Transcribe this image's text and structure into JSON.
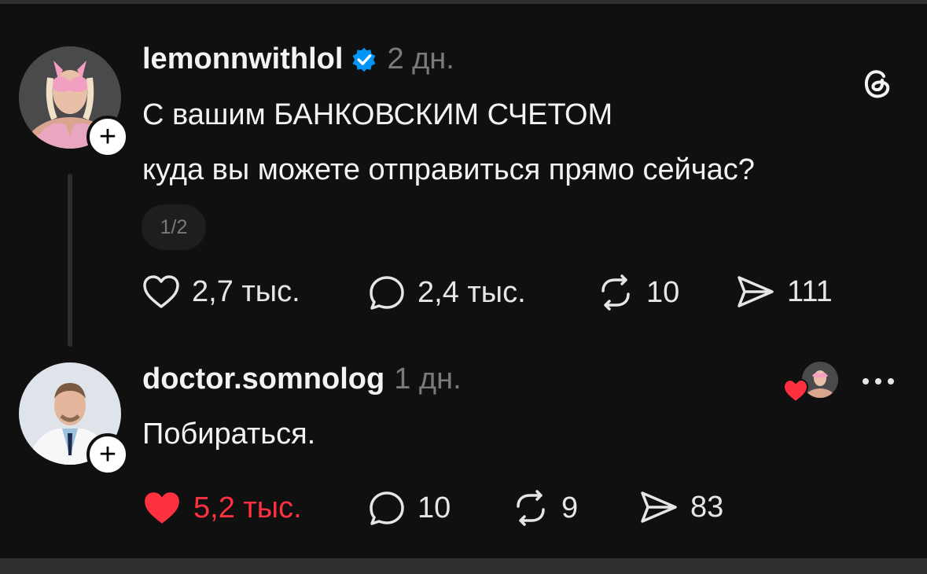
{
  "post": {
    "username": "lemonnwithlol",
    "verified": true,
    "timestamp": "2 дн.",
    "text_line1": "С вашим БАНКОВСКИМ СЧЕТОМ",
    "text_line2": "куда вы можете отправиться прямо сейчас?",
    "page_indicator": "1/2",
    "likes": "2,7 тыс.",
    "comments": "2,4 тыс.",
    "reposts": "10",
    "shares": "111",
    "liked": false
  },
  "reply": {
    "username": "doctor.somnolog",
    "timestamp": "1 дн.",
    "text": "Побираться.",
    "likes": "5,2 тыс.",
    "comments": "10",
    "reposts": "9",
    "shares": "83",
    "liked": true
  },
  "icons": {
    "app_logo": "threads-logo-icon",
    "like": "heart-icon",
    "comment": "comment-bubble-icon",
    "repost": "repost-icon",
    "share": "send-icon",
    "more": "more-options-icon",
    "follow": "plus-icon",
    "verified": "verified-badge-icon"
  },
  "colors": {
    "background": "#101010",
    "text": "#f3f3f3",
    "muted": "#7a7a7a",
    "liked_red": "#ff3040",
    "verified_blue": "#0095f6"
  }
}
